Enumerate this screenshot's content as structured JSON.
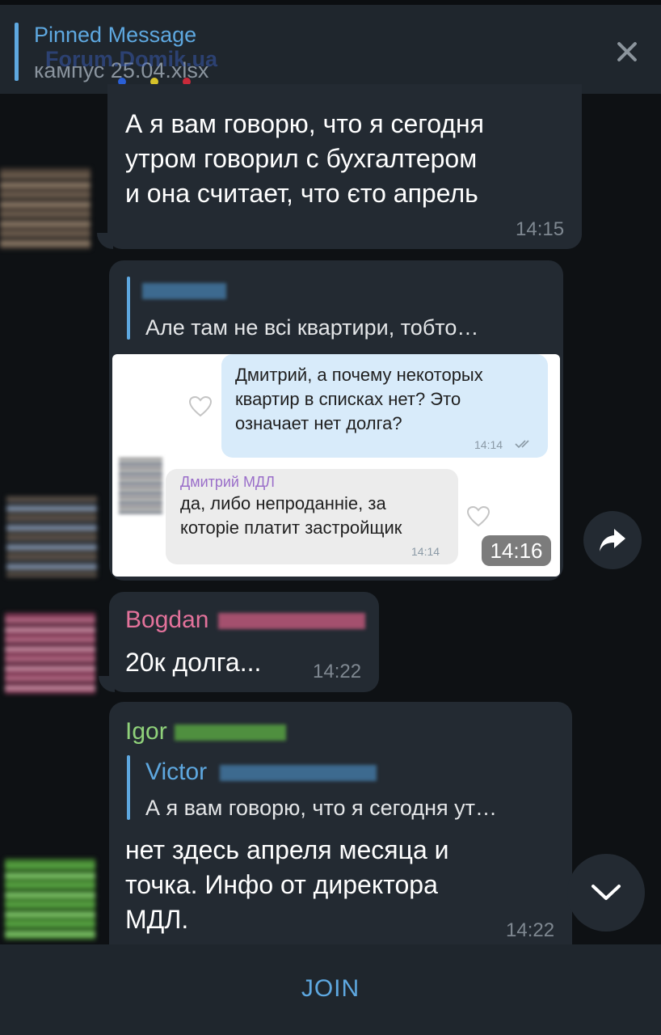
{
  "pinned": {
    "title": "Pinned Message",
    "subtitle": "кампус 25.04.xlsx",
    "watermark": "Forum.Domik.ua"
  },
  "messages": [
    {
      "text_lines": [
        "А я вам говорю, что я сегодня",
        "утром говорил с бухгалтером",
        "и она считает, что єто апрель"
      ],
      "time": "14:15"
    },
    {
      "reply_text": "Але там не всі квартири, тобто…",
      "screenshot": {
        "outgoing_lines": [
          "Дмитрий, а почему некоторых",
          "квартир в списках нет? Это",
          "означает нет долга?"
        ],
        "outgoing_time": "14:14",
        "incoming_name": "Дмитрий МДЛ",
        "incoming_lines": [
          "да, либо непроданніе, за",
          "которіе платит застройщик"
        ],
        "incoming_time": "14:14"
      },
      "time": "14:16"
    },
    {
      "sender": "Bogdan",
      "sender_color": "#e3729b",
      "text": "20к долга...",
      "time": "14:22"
    },
    {
      "sender": "Igor",
      "sender_color": "#8fd17a",
      "reply_name": "Victor",
      "reply_text": "А я вам говорю, что я сегодня ут…",
      "text_lines": [
        "нет здесь апреля месяца и",
        "точка. Инфо от директора",
        "МДЛ."
      ],
      "time": "14:22"
    }
  ],
  "join_label": "JOIN",
  "colors": {
    "accent": "#5ea8e0",
    "background": "#0e1114",
    "bubble": "#232a32",
    "panel": "#1f262d"
  }
}
